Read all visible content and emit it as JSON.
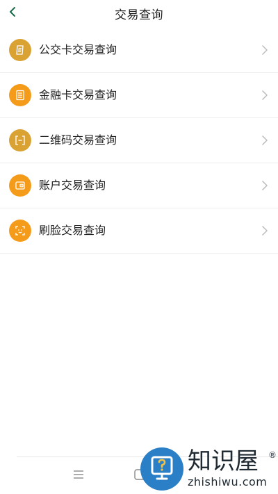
{
  "header": {
    "title": "交易查询",
    "back_icon": "chevron-left-icon"
  },
  "menu": {
    "items": [
      {
        "label": "公交卡交易查询",
        "icon": "bus-card-icon",
        "color": "#d9a232"
      },
      {
        "label": "金融卡交易查询",
        "icon": "receipt-icon",
        "color": "#f59b1a"
      },
      {
        "label": "二维码交易查询",
        "icon": "scan-code-icon",
        "color": "#d9a232"
      },
      {
        "label": "账户交易查询",
        "icon": "wallet-icon",
        "color": "#f59b1a"
      },
      {
        "label": "刷脸交易查询",
        "icon": "face-scan-icon",
        "color": "#f59b1a"
      }
    ]
  },
  "nav_bar": {
    "menu_icon": "menu-icon",
    "home_icon": "home-icon"
  },
  "watermark": {
    "brand": "知识屋",
    "registered": "®",
    "url": "zhishiwu.com",
    "icon": "question-monitor-icon",
    "color": "#2b7fc6"
  },
  "colors": {
    "accent_green": "#1a6b4a",
    "icon_gold": "#d9a232",
    "icon_orange": "#f59b1a",
    "chevron": "#bbbbbb"
  }
}
